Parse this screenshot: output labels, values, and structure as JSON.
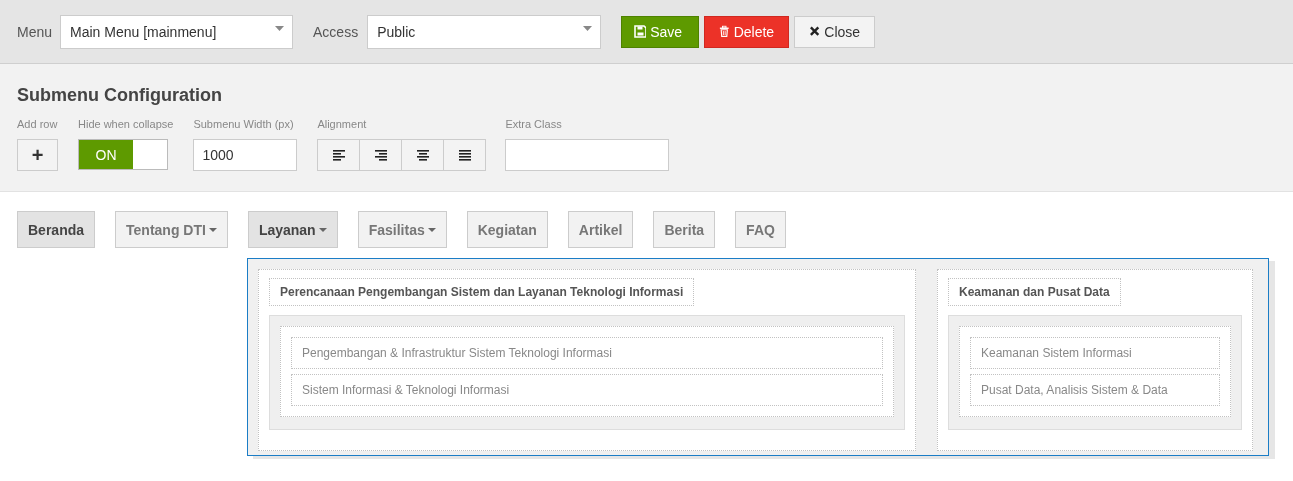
{
  "toolbar": {
    "menu_label": "Menu",
    "menu_value": "Main Menu [mainmenu]",
    "access_label": "Access",
    "access_value": "Public",
    "buttons": [
      {
        "kind": "save",
        "label": "Save"
      },
      {
        "kind": "delete",
        "label": "Delete"
      },
      {
        "kind": "close",
        "label": "Close"
      }
    ]
  },
  "config": {
    "title": "Submenu Configuration",
    "add_row_label": "Add row",
    "add_row_button": "+",
    "hide_label": "Hide when collapse",
    "hide_toggle": {
      "on": true,
      "label": "ON"
    },
    "width_label": "Submenu Width (px)",
    "width_value": "1000",
    "alignment_label": "Alignment",
    "alignments": [
      {
        "kind": "left"
      },
      {
        "kind": "right"
      },
      {
        "kind": "center"
      },
      {
        "kind": "justify"
      }
    ],
    "extra_label": "Extra Class"
  },
  "menu_items": [
    {
      "label": "Beranda",
      "highlighted": true,
      "caret": false
    },
    {
      "label": "Tentang DTI",
      "highlighted": false,
      "caret": true
    },
    {
      "label": "Layanan",
      "highlighted": true,
      "caret": true
    },
    {
      "label": "Fasilitas",
      "highlighted": false,
      "caret": true
    },
    {
      "label": "Kegiatan",
      "highlighted": false,
      "caret": false
    },
    {
      "label": "Artikel",
      "highlighted": false,
      "caret": false
    },
    {
      "label": "Berita",
      "highlighted": false,
      "caret": false
    },
    {
      "label": "FAQ",
      "highlighted": false,
      "caret": false
    }
  ],
  "submenu": {
    "columns": [
      {
        "title": "Perencanaan Pengembangan Sistem dan Layanan Teknologi Informasi",
        "items": [
          "Pengembangan & Infrastruktur Sistem Teknologi Informasi",
          "Sistem Informasi & Teknologi Informasi"
        ]
      },
      {
        "title": "Keamanan dan Pusat Data",
        "items": [
          "Keamanan Sistem Informasi",
          "Pusat Data, Analisis Sistem & Data"
        ]
      }
    ]
  }
}
